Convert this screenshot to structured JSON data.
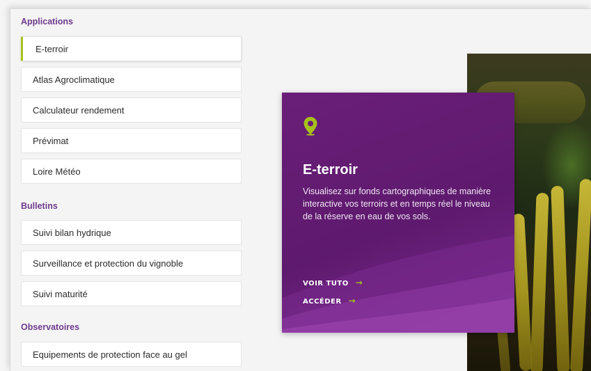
{
  "sections": {
    "applications": {
      "title": "Applications",
      "items": [
        "E-terroir",
        "Atlas Agroclimatique",
        "Calculateur rendement",
        "Prévimat",
        "Loire Météo"
      ]
    },
    "bulletins": {
      "title": "Bulletins",
      "items": [
        "Suivi bilan hydrique",
        "Surveillance et protection du vignoble",
        "Suivi maturité"
      ]
    },
    "observatoires": {
      "title": "Observatoires",
      "items": [
        "Equipements de protection face au gel"
      ]
    }
  },
  "card": {
    "title": "E-terroir",
    "description": "Visualisez sur fonds cartographiques de manière interactive vos terroirs et en temps réel le niveau de la réserve en eau de vos sols.",
    "link_tuto": "VOIR TUTO",
    "link_access": "ACCÉDER",
    "arrow": "→",
    "icon": "map-pin-icon"
  },
  "colors": {
    "accent": "#a6c21b",
    "section_title": "#6e3a8c",
    "card_bg": "#5e1a6e"
  }
}
